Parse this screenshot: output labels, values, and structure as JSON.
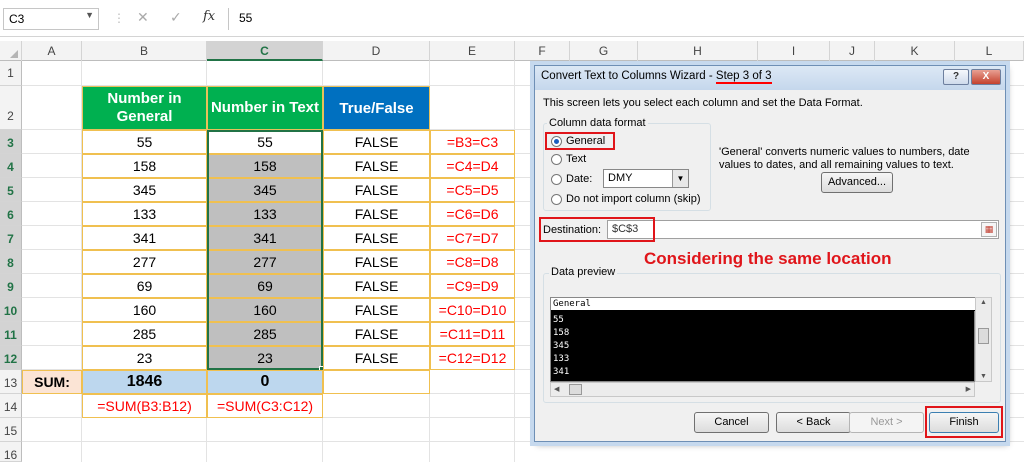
{
  "formula_bar": {
    "name_box": "C3",
    "fx": "fx",
    "content": "55"
  },
  "columns": [
    "A",
    "B",
    "C",
    "D",
    "E",
    "F",
    "G",
    "H",
    "I",
    "J",
    "K",
    "L"
  ],
  "rows": [
    "1",
    "2",
    "3",
    "4",
    "5",
    "6",
    "7",
    "8",
    "9",
    "10",
    "11",
    "12",
    "13",
    "14",
    "15",
    "16"
  ],
  "headers": {
    "b": "Number in General",
    "c": "Number in Text",
    "d": "True/False"
  },
  "b_values": [
    "55",
    "158",
    "345",
    "133",
    "341",
    "277",
    "69",
    "160",
    "285",
    "23"
  ],
  "c_values": [
    "55",
    "158",
    "345",
    "133",
    "341",
    "277",
    "69",
    "160",
    "285",
    "23"
  ],
  "d_values": [
    "FALSE",
    "FALSE",
    "FALSE",
    "FALSE",
    "FALSE",
    "FALSE",
    "FALSE",
    "FALSE",
    "FALSE",
    "FALSE"
  ],
  "e_formulas": [
    "=B3=C3",
    "=C4=D4",
    "=C5=D5",
    "=C6=D6",
    "=C7=D7",
    "=C8=D8",
    "=C9=D9",
    "=C10=D10",
    "=C11=D11",
    "=C12=D12"
  ],
  "sum_row": {
    "label": "SUM:",
    "b": "1846",
    "c": "0"
  },
  "formula_row": {
    "b": "=SUM(B3:B12)",
    "c": "=SUM(C3:C12)"
  },
  "dialog": {
    "title_prefix": "Convert Text to Columns Wizard - ",
    "title_step": "Step 3 of 3",
    "help": "?",
    "close": "X",
    "intro": "This screen lets you select each column and set the Data Format.",
    "format_group": "Column data format",
    "opt_general": "General",
    "opt_text": "Text",
    "opt_date": "Date:",
    "date_format": "DMY",
    "opt_skip": "Do not import column (skip)",
    "description": "'General' converts numeric values to numbers, date values to dates, and all remaining values to text.",
    "advanced": "Advanced...",
    "destination_label": "Destination:",
    "destination_value": "$C$3",
    "annotation": "Considering the same location",
    "preview_group": "Data preview",
    "preview_header": "General",
    "preview_rows": [
      "55",
      "158",
      "345",
      "133",
      "341"
    ],
    "cancel": "Cancel",
    "back": "< Back",
    "next": "Next >",
    "finish": "Finish"
  },
  "colors": {
    "green": "#00b050",
    "blue": "#0070c0",
    "red": "#ff0000",
    "gray": "#bfbfbf",
    "sum_orange": "#fbe4d5",
    "sum_blue": "#bdd7ee"
  }
}
